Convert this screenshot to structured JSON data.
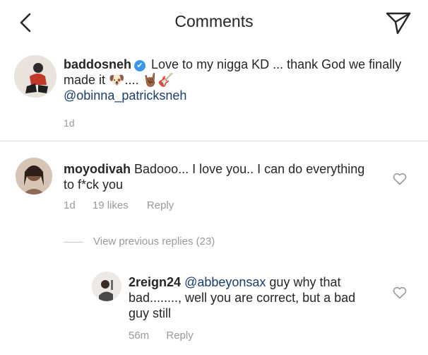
{
  "header": {
    "title": "Comments",
    "back_icon": "chevron-left-icon",
    "send_icon": "paper-plane-icon"
  },
  "caption": {
    "username": "baddosneh",
    "text_1": " Love to my nigga KD ... thank God we finally made it ",
    "ellipsis": "....",
    "mention": "@obinna_patricksneh",
    "time": "1d"
  },
  "comments": [
    {
      "username": "moyodivah",
      "text": " Badooo... I love you.. I can do everything to f*ck you",
      "time": "1d",
      "likes": "19 likes",
      "reply": "Reply"
    }
  ],
  "view_previous": "View previous replies (23)",
  "reply_comment": {
    "username": "2reign24",
    "mention": "@abbeyonsax",
    "text": " guy why that bad........, well you are correct,  but a bad guy still",
    "time": "56m",
    "reply": "Reply"
  },
  "colors": {
    "text": "#262626",
    "meta": "#999999",
    "verified": "#3897f0",
    "mention": "#1a3d6e",
    "divider": "#dbdbdb"
  }
}
